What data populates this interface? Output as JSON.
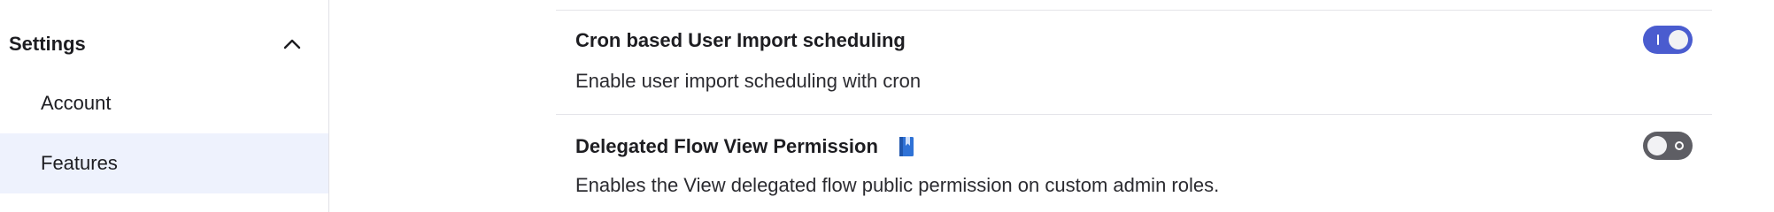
{
  "sidebar": {
    "section": {
      "title": "Settings",
      "icon": "chevron-up-icon",
      "expanded": true
    },
    "items": [
      {
        "label": "Account",
        "selected": false
      },
      {
        "label": "Features",
        "selected": true
      }
    ]
  },
  "settings": [
    {
      "title": "Cron based User Import scheduling",
      "description": "Enable user import scheduling with cron",
      "enabled": true,
      "icon": null
    },
    {
      "title": "Delegated Flow View Permission",
      "description": "Enables the View delegated flow public permission on custom admin roles.",
      "enabled": false,
      "icon": "book-icon"
    }
  ],
  "colors": {
    "accent": "#4a5ccf",
    "toggle_off": "#5e5e64",
    "selected_item_bg": "#eef2fd",
    "book_icon": "#2f72d6"
  }
}
